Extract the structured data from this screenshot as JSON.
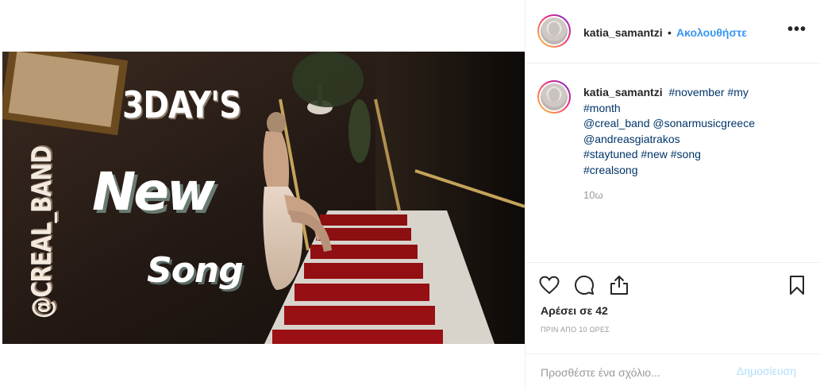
{
  "header": {
    "username": "katia_samantzi",
    "separator": "•",
    "follow_label": "Ακολουθήστε",
    "more_label": "•••"
  },
  "media": {
    "line1": "3DAY'S",
    "line2": "New",
    "line3": "Song",
    "side_text": "@CREAL_BAND"
  },
  "caption": {
    "username": "katia_samantzi",
    "tags_line1": [
      "#november",
      "#my"
    ],
    "tags_line2": "#month",
    "mentions_line1": "@creal_band @sonarmusicgreece",
    "mentions_line2": "@andreasgiatrakos",
    "tags_line3": "#staytuned #new #song",
    "tags_line4": "#crealsong",
    "time": "10ω"
  },
  "actions": {
    "likes": "Αρέσει σε 42",
    "ago": "ΠΡΙΝ ΑΠΟ 10 ΩΡΕΣ"
  },
  "comment_box": {
    "placeholder": "Προσθέστε ένα σχόλιο...",
    "post_label": "Δημοσίευση"
  },
  "icons": {
    "heart": "heart-icon",
    "comment": "comment-icon",
    "share": "share-icon",
    "save": "bookmark-icon"
  }
}
